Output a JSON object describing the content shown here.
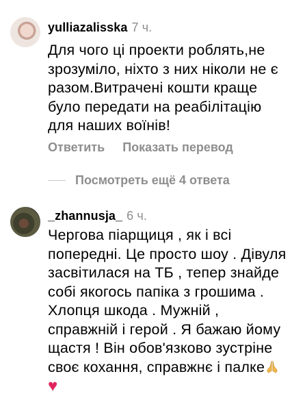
{
  "comments": [
    {
      "username": "yulliazalisska",
      "time": "7 ч.",
      "text": "Для чого ці проекти роблять,не зрозуміло, ніхто з них ніколи не є разом.Витрачені кошти краще було передати на реабілітацію для наших воїнів!",
      "reply_label": "Ответить",
      "translate_label": "Показать перевод",
      "view_replies_label": "Посмотреть ещё 4 ответа"
    },
    {
      "username": "_zhannusja_",
      "time": "6 ч.",
      "text": "Чергова піарщиця , як і всі попередні. Це просто шоу . Дівуля засвітилася на ТБ , тепер знайде собі якогось папіка з грошима . Хлопця шкода . Мужній , справжній і герой . Я бажаю йому щастя ! Він обов'язково зустріне своє кохання,  справжнє і палке",
      "emoji_heart": "♥"
    }
  ],
  "colors": {
    "meta": "#8e8e8e",
    "heart": "#e0245e",
    "pray": "#f2b84b"
  }
}
